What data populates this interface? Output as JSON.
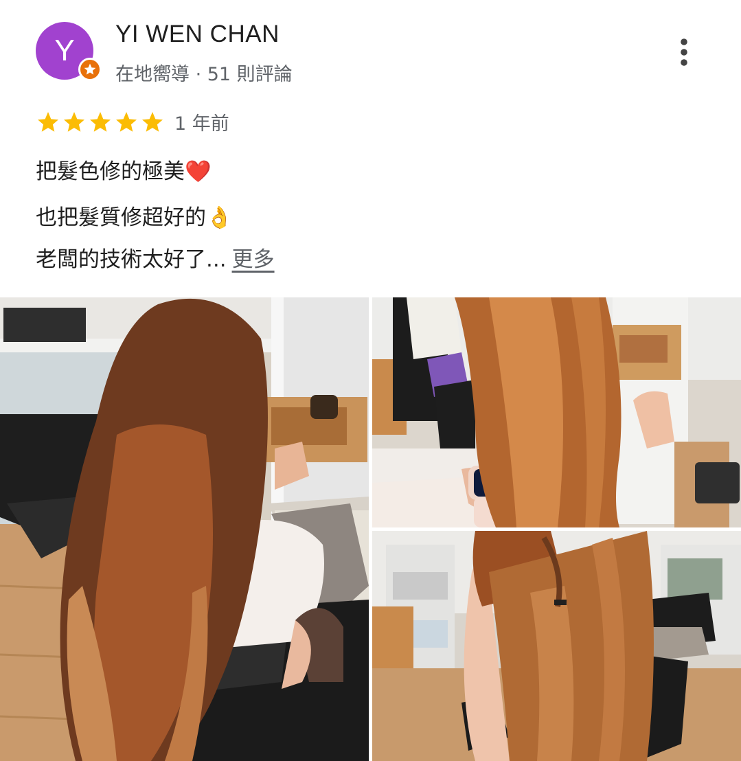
{
  "reviewer": {
    "initial": "Y",
    "name": "YI WEN CHAN",
    "meta": "在地嚮導 · 51 則評論",
    "avatar_color": "#a142cf",
    "badge_color": "#e8710a"
  },
  "review": {
    "rating": 5,
    "time_ago": "1 年前",
    "line1": "把髮色修的極美",
    "line1_emoji": "❤️",
    "line2": "也把髮質修超好的",
    "line2_emoji": "👌",
    "line3": "老闆的技術太好了...",
    "more_label": "更多"
  },
  "icons": {
    "badge": "star-icon",
    "menu": "more-vert-icon",
    "rating": "star-icon"
  },
  "colors": {
    "star": "#fbbc04",
    "secondary_text": "#5f6368"
  },
  "photos": [
    {
      "name": "salon-photo-long-hair-back"
    },
    {
      "name": "salon-photo-straight-hair-hand"
    },
    {
      "name": "salon-photo-hair-side-view"
    }
  ]
}
